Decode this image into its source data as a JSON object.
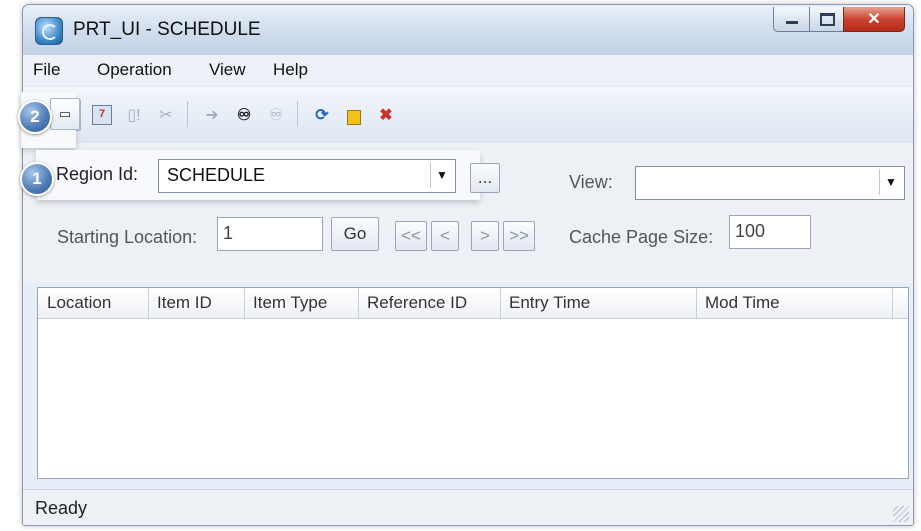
{
  "window": {
    "title": "PRT_UI - SCHEDULE"
  },
  "menu": {
    "items": [
      "File",
      "Operation",
      "View",
      "Help"
    ]
  },
  "toolbar": {
    "buttons": [
      {
        "icon": "new-item-icon",
        "state": "enabled"
      },
      {
        "icon": "calendar-icon",
        "state": "enabled"
      },
      {
        "icon": "document-alert-icon",
        "state": "disabled"
      },
      {
        "icon": "tools-icon",
        "state": "disabled"
      },
      {
        "icon": "arrow-right-icon",
        "state": "disabled"
      },
      {
        "icon": "binoculars-icon",
        "state": "enabled"
      },
      {
        "icon": "binoculars-filter-icon",
        "state": "disabled"
      },
      {
        "icon": "refresh-icon",
        "state": "enabled"
      },
      {
        "icon": "lock-icon",
        "state": "enabled"
      },
      {
        "icon": "delete-icon",
        "state": "enabled"
      }
    ]
  },
  "callouts": {
    "one": "1",
    "two": "2"
  },
  "form": {
    "region_label": "Region Id:",
    "region_value": "SCHEDULE",
    "browse_label": "...",
    "view_label": "View:",
    "view_value": "",
    "start_label": "Starting Location:",
    "start_value": "1",
    "go_label": "Go",
    "nav_first": "<<",
    "nav_prev": "<",
    "nav_next": ">",
    "nav_last": ">>",
    "cache_label": "Cache Page Size:",
    "cache_value": "100"
  },
  "grid": {
    "columns": [
      "Location",
      "Item ID",
      "Item Type",
      "Reference ID",
      "Entry Time",
      "Mod Time"
    ],
    "rows": []
  },
  "status": {
    "text": "Ready"
  },
  "colors": {
    "accent": "#4d79b4",
    "close": "#c9452f",
    "window_bg": "#e7eef7"
  }
}
